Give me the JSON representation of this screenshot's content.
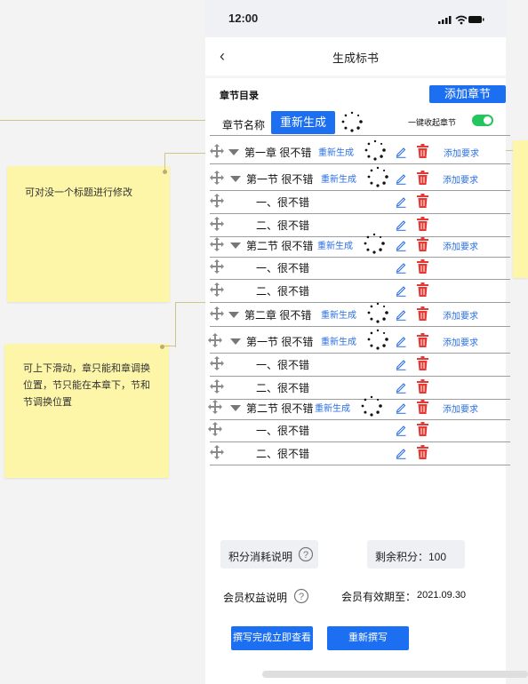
{
  "status_bar": {
    "time": "12:00"
  },
  "header": {
    "back_icon": "chevron-left-icon",
    "title": "生成标书"
  },
  "toc": {
    "label": "章节目录",
    "add_chapter": "添加章节",
    "name_label": "章节名称",
    "regenerate_all": "重新生成",
    "collapse_label": "一键收起章节",
    "collapse_on": true
  },
  "rows": [
    {
      "text": "第一章  很不错",
      "regen": "重新生成",
      "req": "添加要求"
    },
    {
      "text": "第一节  很不错",
      "regen": "重新生成",
      "req": "添加要求"
    },
    {
      "text": "一、很不错"
    },
    {
      "text": "二、很不错"
    },
    {
      "text": "第二节  很不错",
      "regen": "重新生成",
      "req": "添加要求"
    },
    {
      "text": "一、很不错"
    },
    {
      "text": "二、很不错"
    },
    {
      "text": "第二章  很不错",
      "regen": "重新生成",
      "req": "添加要求"
    },
    {
      "text": "第一节  很不错",
      "regen": "重新生成",
      "req": "添加要求"
    },
    {
      "text": "一、很不错"
    },
    {
      "text": "二、很不错"
    },
    {
      "text": "第二节  很不错",
      "regen": "重新生成",
      "req": "添加要求"
    },
    {
      "text": "一、很不错"
    },
    {
      "text": "二、很不错"
    }
  ],
  "footer": {
    "points_explain": "积分消耗说明",
    "remaining_points": "剩余积分：100",
    "member_rights": "会员权益说明",
    "member_expiry_label": "会员有效期至：",
    "member_expiry_date": "2021.09.30",
    "write_view_button": "撰写完成立即查看",
    "rewrite_button": "重新撰写"
  },
  "notes": [
    {
      "text": "可对没一个标题进行修改"
    },
    {
      "text": "可上下滑动，章只能和章调换位置，节只能在本章下，节和节调换位置"
    }
  ],
  "colors": {
    "accent": "#1d6ff2",
    "delete": "#e53935",
    "toggle": "#22c55e",
    "note": "#fdf6a9"
  }
}
